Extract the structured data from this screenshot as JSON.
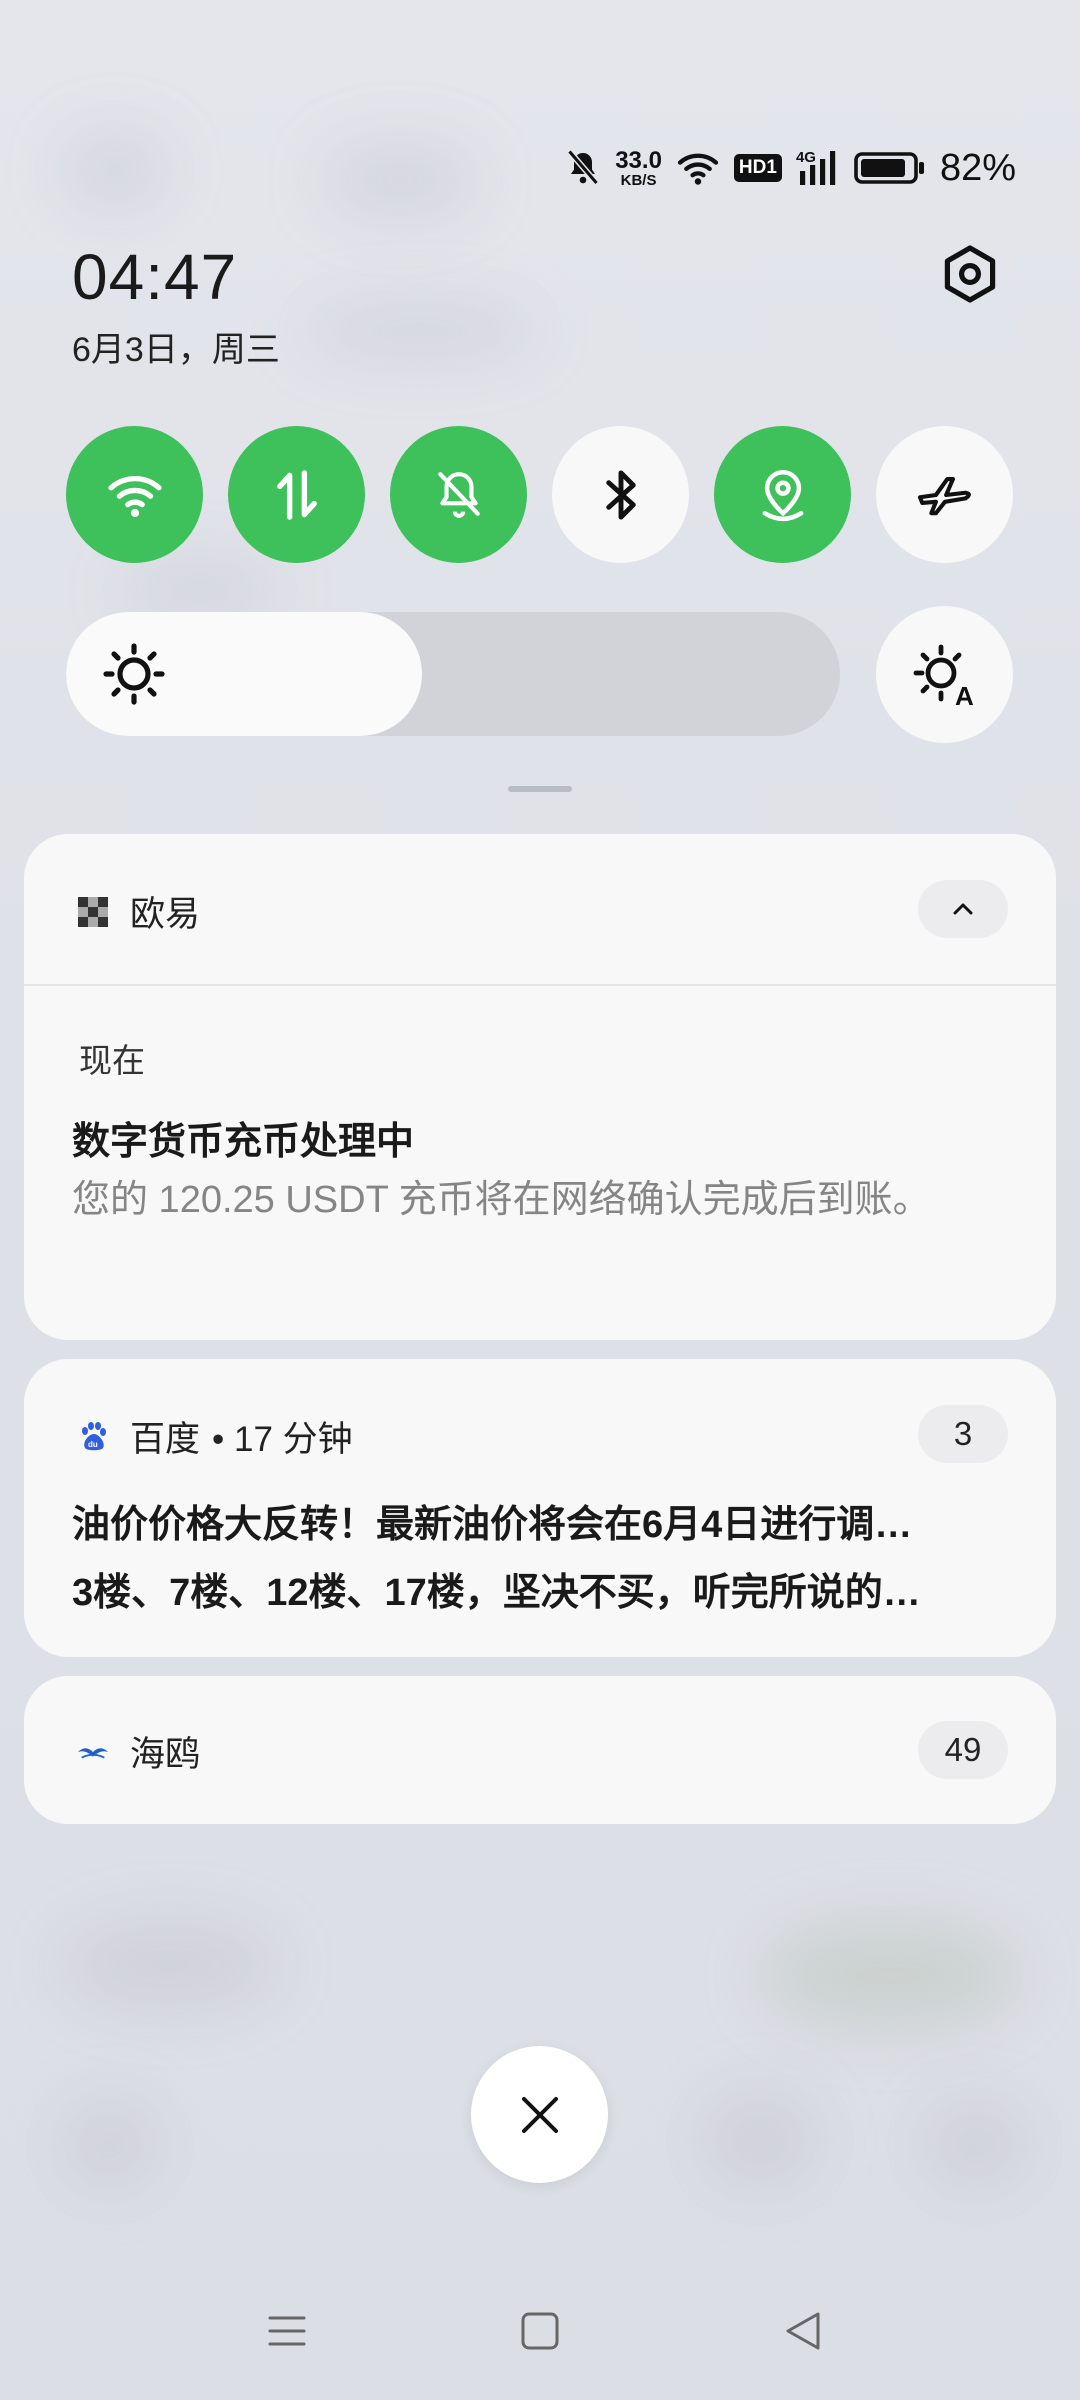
{
  "status_bar": {
    "speed_value": "33.0",
    "speed_unit": "KB/S",
    "hd_label": "HD1",
    "network_label": "4G",
    "battery_percent": "82%",
    "icons": [
      "mute-icon",
      "wifi-icon",
      "hd-icon",
      "signal-icon",
      "battery-icon"
    ]
  },
  "header": {
    "time": "04:47",
    "date": "6月3日，周三"
  },
  "quick_toggles": [
    {
      "name": "wifi",
      "icon": "wifi-icon",
      "on": true
    },
    {
      "name": "mobile-data",
      "icon": "data-arrows-icon",
      "on": true
    },
    {
      "name": "do-not-disturb",
      "icon": "bell-off-icon",
      "on": true
    },
    {
      "name": "bluetooth",
      "icon": "bluetooth-icon",
      "on": false
    },
    {
      "name": "location",
      "icon": "location-icon",
      "on": true
    },
    {
      "name": "airplane-mode",
      "icon": "airplane-icon",
      "on": false
    }
  ],
  "brightness": {
    "level": 0.46,
    "auto_icon": "auto-brightness-icon"
  },
  "notifications": [
    {
      "app": "欧易",
      "time": "现在",
      "title": "数字货币充币处理中",
      "body": "您的 120.25 USDT 充币将在网络确认完成后到账。"
    },
    {
      "app": "百度",
      "meta": "• 17 分钟",
      "count": "3",
      "lines": [
        "油价价格大反转！最新油价将会在6月4日进行调…",
        "3楼、7楼、12楼、17楼，坚决不买，听完所说的…"
      ]
    },
    {
      "app": "海鸥",
      "count": "49"
    }
  ],
  "colors": {
    "toggle_on": "#3ec05a",
    "card_bg": "#f8f8f9"
  }
}
